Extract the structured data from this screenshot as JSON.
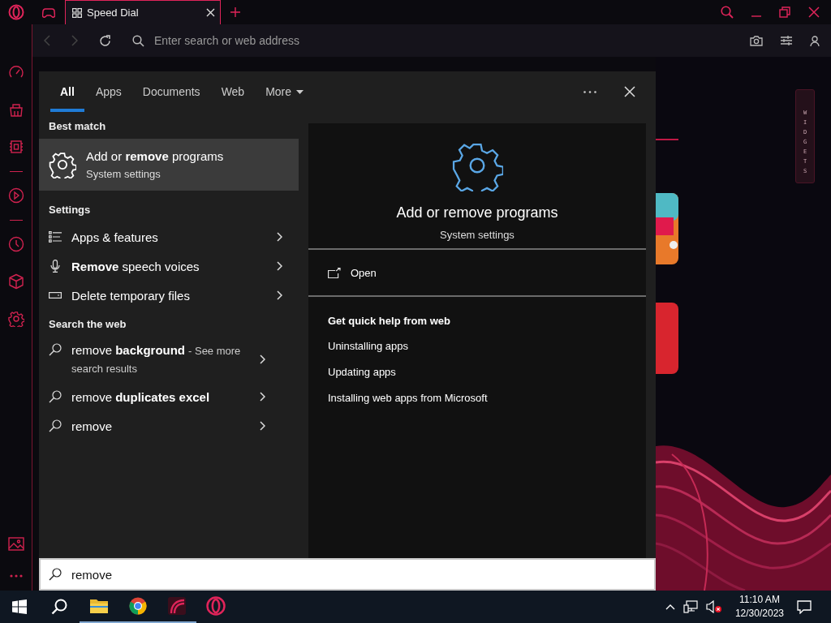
{
  "browser": {
    "tabs": [
      {
        "kind": "icon",
        "selected": false
      },
      {
        "kind": "page",
        "label": "Speed Dial",
        "selected": true
      }
    ],
    "address_bar": {
      "placeholder": "Enter search or web address"
    },
    "widgets_tab": {
      "label": "WIDGETS"
    }
  },
  "search_flyout": {
    "tabs": [
      {
        "label": "All",
        "selected": true
      },
      {
        "label": "Apps",
        "selected": false
      },
      {
        "label": "Documents",
        "selected": false
      },
      {
        "label": "Web",
        "selected": false
      },
      {
        "label": "More",
        "selected": false
      }
    ],
    "best_match": {
      "heading": "Best match",
      "title": "Add or **remove** programs",
      "subtitle": "System settings",
      "selected": true
    },
    "settings": {
      "heading": "Settings",
      "items": [
        {
          "kind": "list",
          "label": "Apps & features"
        },
        {
          "kind": "mic",
          "label": "**Remove** speech voices"
        },
        {
          "kind": "storage",
          "label": "Delete temporary files"
        }
      ]
    },
    "web": {
      "heading": "Search the web",
      "items": [
        {
          "label": "remove **background**",
          "note": "- See more search results"
        },
        {
          "label": "remove **duplicates excel**"
        },
        {
          "label": "remove"
        }
      ]
    },
    "preview": {
      "title": "Add or remove programs",
      "subtitle": "System settings",
      "action": "Open",
      "help_heading": "Get quick help from web",
      "links": [
        "Uninstalling apps",
        "Updating apps",
        "Installing web apps from Microsoft"
      ]
    },
    "query": "remove"
  },
  "taskbar": {
    "apps": [
      {
        "kind": "explorer",
        "running": true
      },
      {
        "kind": "chrome",
        "running": true
      },
      {
        "kind": "app",
        "running": true
      },
      {
        "kind": "opera",
        "running": false
      }
    ],
    "time": "11:10 AM",
    "date": "12/30/2023"
  }
}
